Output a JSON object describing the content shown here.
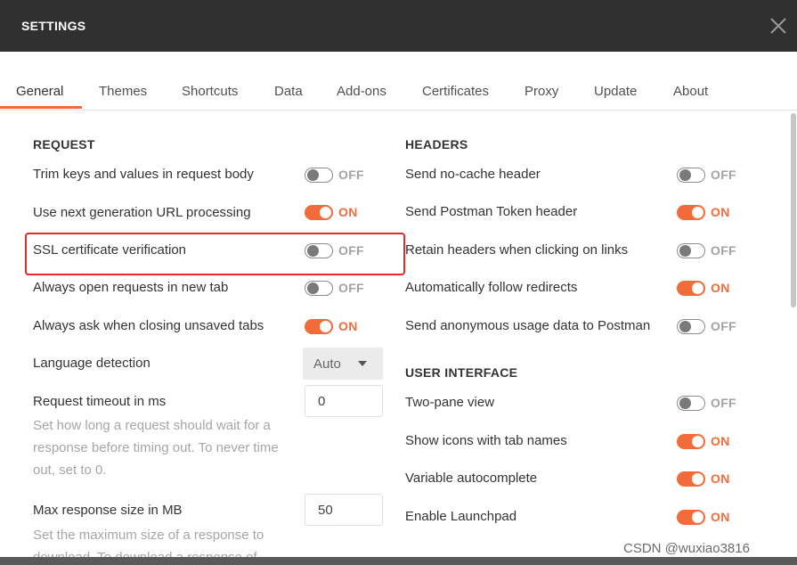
{
  "window": {
    "title": "SETTINGS",
    "close_icon": "close-icon"
  },
  "tabs": [
    {
      "label": "General",
      "active": true
    },
    {
      "label": "Themes"
    },
    {
      "label": "Shortcuts"
    },
    {
      "label": "Data"
    },
    {
      "label": "Add-ons"
    },
    {
      "label": "Certificates"
    },
    {
      "label": "Proxy"
    },
    {
      "label": "Update"
    },
    {
      "label": "About"
    }
  ],
  "request": {
    "title": "REQUEST",
    "trim_keys": {
      "label": "Trim keys and values in request body",
      "state": "OFF"
    },
    "url_processing": {
      "label": "Use next generation URL processing",
      "state": "ON"
    },
    "ssl_verification": {
      "label": "SSL certificate verification",
      "state": "OFF"
    },
    "new_tab": {
      "label": "Always open requests in new tab",
      "state": "OFF"
    },
    "ask_unsaved": {
      "label": "Always ask when closing unsaved tabs",
      "state": "ON"
    },
    "language_detection": {
      "label": "Language detection",
      "value": "Auto"
    },
    "timeout": {
      "label": "Request timeout in ms",
      "value": "0",
      "help": "Set how long a request should wait for a response before timing out. To never time out, set to 0."
    },
    "max_response": {
      "label": "Max response size in MB",
      "value": "50",
      "help": "Set the maximum size of a response to download. To download a response of"
    }
  },
  "headers": {
    "title": "HEADERS",
    "no_cache": {
      "label": "Send no-cache header",
      "state": "OFF"
    },
    "postman_token": {
      "label": "Send Postman Token header",
      "state": "ON"
    },
    "retain_headers": {
      "label": "Retain headers when clicking on links",
      "state": "OFF"
    },
    "follow_redirects": {
      "label": "Automatically follow redirects",
      "state": "ON"
    },
    "anonymous_usage": {
      "label": "Send anonymous usage data to Postman",
      "state": "OFF"
    }
  },
  "user_interface": {
    "title": "USER INTERFACE",
    "two_pane": {
      "label": "Two-pane view",
      "state": "OFF"
    },
    "show_icons": {
      "label": "Show icons with tab names",
      "state": "ON"
    },
    "variable_autocomplete": {
      "label": "Variable autocomplete",
      "state": "ON"
    },
    "launchpad": {
      "label": "Enable Launchpad",
      "state": "ON"
    }
  },
  "watermark": "CSDN @wuxiao3816",
  "colors": {
    "accent": "#f26b3a",
    "titlebar": "#303030",
    "highlight": "#e8262c"
  }
}
